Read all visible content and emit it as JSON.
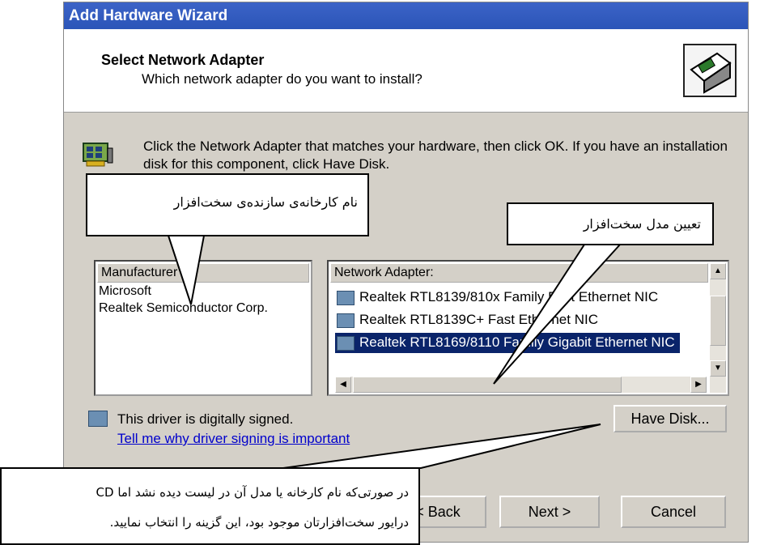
{
  "window": {
    "title": "Add Hardware Wizard"
  },
  "header": {
    "title": "Select Network Adapter",
    "subtitle": "Which network adapter do you want to install?"
  },
  "intro": {
    "text": "Click the Network Adapter that matches your hardware, then click OK. If you have an installation disk for this component, click Have Disk."
  },
  "manufacturer": {
    "header": "Manufacturer",
    "items": [
      "Microsoft",
      "Realtek Semiconductor Corp."
    ]
  },
  "adapters": {
    "header": "Network Adapter:",
    "items": [
      "Realtek RTL8139/810x Family Fast Ethernet NIC",
      "Realtek RTL8139C+ Fast Ethernet NIC",
      "Realtek RTL8169/8110 Family Gigabit Ethernet NIC"
    ],
    "selected_index": 2
  },
  "driver": {
    "signed_text": "This driver is digitally signed.",
    "link_text": "Tell me why driver signing is important"
  },
  "buttons": {
    "have_disk": "Have Disk...",
    "back": "< Back",
    "next": "Next >",
    "cancel": "Cancel"
  },
  "annotations": {
    "manufacturer_note": "نام کارخانه‌ی سازنده‌ی سخت‌افزار",
    "model_note": "تعیین مدل سخت‌افزار",
    "have_disk_note_line1": "در صورتی‌که نام کارخانه یا مدل آن در لیست دیده نشد اما CD",
    "have_disk_note_line2": "درایور سخت‌افزارتان موجود بود، این گزینه را انتخاب نمایید."
  },
  "colors": {
    "titlebar": "#2b55b8",
    "selection": "#0a246a",
    "dialog": "#d4d0c8",
    "link": "#0000cc"
  }
}
